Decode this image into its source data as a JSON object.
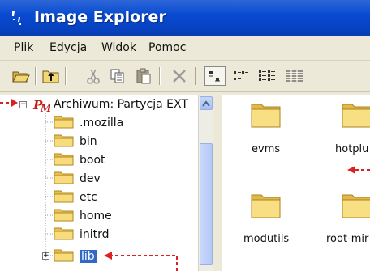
{
  "window": {
    "title": "Image Explorer"
  },
  "menu": [
    {
      "label": "Plik"
    },
    {
      "label": "Edycja"
    },
    {
      "label": "Widok"
    },
    {
      "label": "Pomoc"
    }
  ],
  "toolbar": {
    "buttons": [
      "open-folder-icon",
      "up-folder-icon",
      "cut-icon",
      "copy-icon",
      "paste-icon",
      "delete-icon",
      "large-icons-view-icon",
      "small-icons-view-icon",
      "list-view-icon",
      "details-view-icon"
    ],
    "selected_view": "large-icons-view-icon"
  },
  "tree": {
    "root": {
      "label": "Archiwum: Partycja EXT"
    },
    "items": [
      {
        "label": ".mozilla"
      },
      {
        "label": "bin"
      },
      {
        "label": "boot"
      },
      {
        "label": "dev"
      },
      {
        "label": "etc"
      },
      {
        "label": "home"
      },
      {
        "label": "initrd"
      },
      {
        "label": "lib",
        "selected": true
      }
    ]
  },
  "files": [
    {
      "label": "evms"
    },
    {
      "label": "hotplu"
    },
    {
      "label": "modutils"
    },
    {
      "label": "root-mir"
    }
  ],
  "colors": {
    "titlebar": "#0a4bd1",
    "selection": "#316ac5",
    "folder": "#f6d36b",
    "annotation": "#e02020"
  }
}
